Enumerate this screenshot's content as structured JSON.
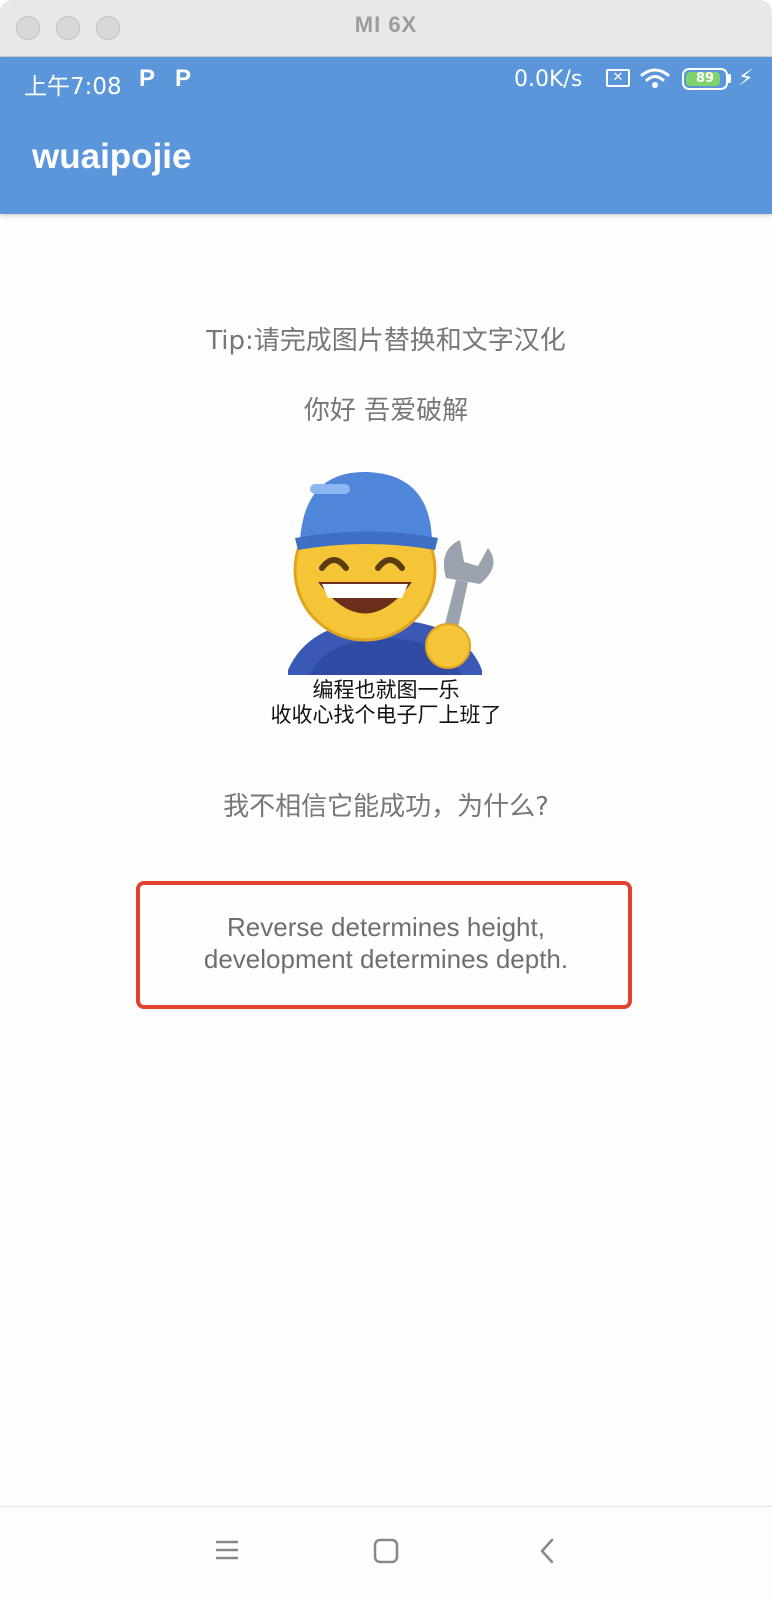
{
  "window": {
    "title": "MI 6X"
  },
  "status_bar": {
    "time": "上午7:08",
    "notification_icon_1": "P",
    "notification_icon_2": "P",
    "net_speed": "0.0K/s",
    "battery_level": "89",
    "battery_fraction": 0.89,
    "charging": true
  },
  "app_bar": {
    "title": "wuaipojie",
    "color": "#5b96db"
  },
  "content": {
    "tip": "Tip:请完成图片替换和文字汉化",
    "greeting": "你好 吾爱破解",
    "meme_caption_line1": "编程也就图一乐",
    "meme_caption_line2": "收收心找个电子厂上班了",
    "question": "我不相信它能成功，为什么?",
    "quote_line1": "Reverse determines height,",
    "quote_line2": "development determines depth.",
    "quote_border_color": "#e04330"
  },
  "nav_bar": {
    "buttons": [
      "menu-icon",
      "home-icon",
      "back-icon"
    ]
  }
}
